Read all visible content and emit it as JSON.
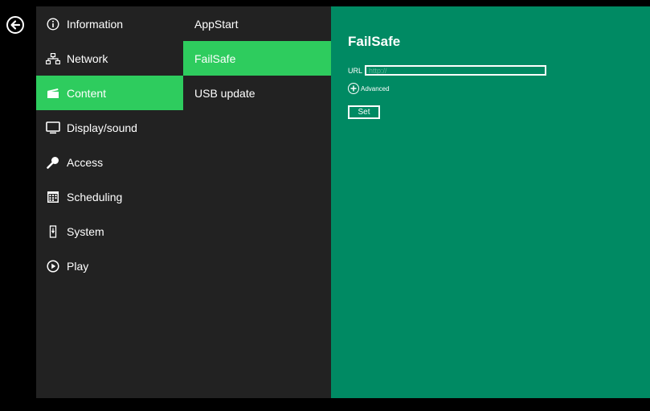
{
  "nav": {
    "back_icon": "arrow-left-circle-icon"
  },
  "menu": {
    "items": [
      {
        "label": "Information",
        "icon": "info-icon"
      },
      {
        "label": "Network",
        "icon": "network-icon"
      },
      {
        "label": "Content",
        "icon": "clapperboard-icon",
        "active": true
      },
      {
        "label": "Display/sound",
        "icon": "monitor-icon"
      },
      {
        "label": "Access",
        "icon": "key-icon"
      },
      {
        "label": "Scheduling",
        "icon": "calendar-icon"
      },
      {
        "label": "System",
        "icon": "system-icon"
      },
      {
        "label": "Play",
        "icon": "play-icon"
      }
    ]
  },
  "submenu": {
    "items": [
      {
        "label": "AppStart"
      },
      {
        "label": "FailSafe",
        "active": true
      },
      {
        "label": "USB update"
      }
    ]
  },
  "panel": {
    "title": "FailSafe",
    "url_label": "URL",
    "url_value": "",
    "url_placeholder": "http://",
    "advanced_label": "Advanced",
    "set_label": "Set"
  },
  "colors": {
    "active_green": "#2ecc5e",
    "panel_green": "#008a63",
    "menu_bg": "#222222",
    "outer_bg": "#000000"
  }
}
